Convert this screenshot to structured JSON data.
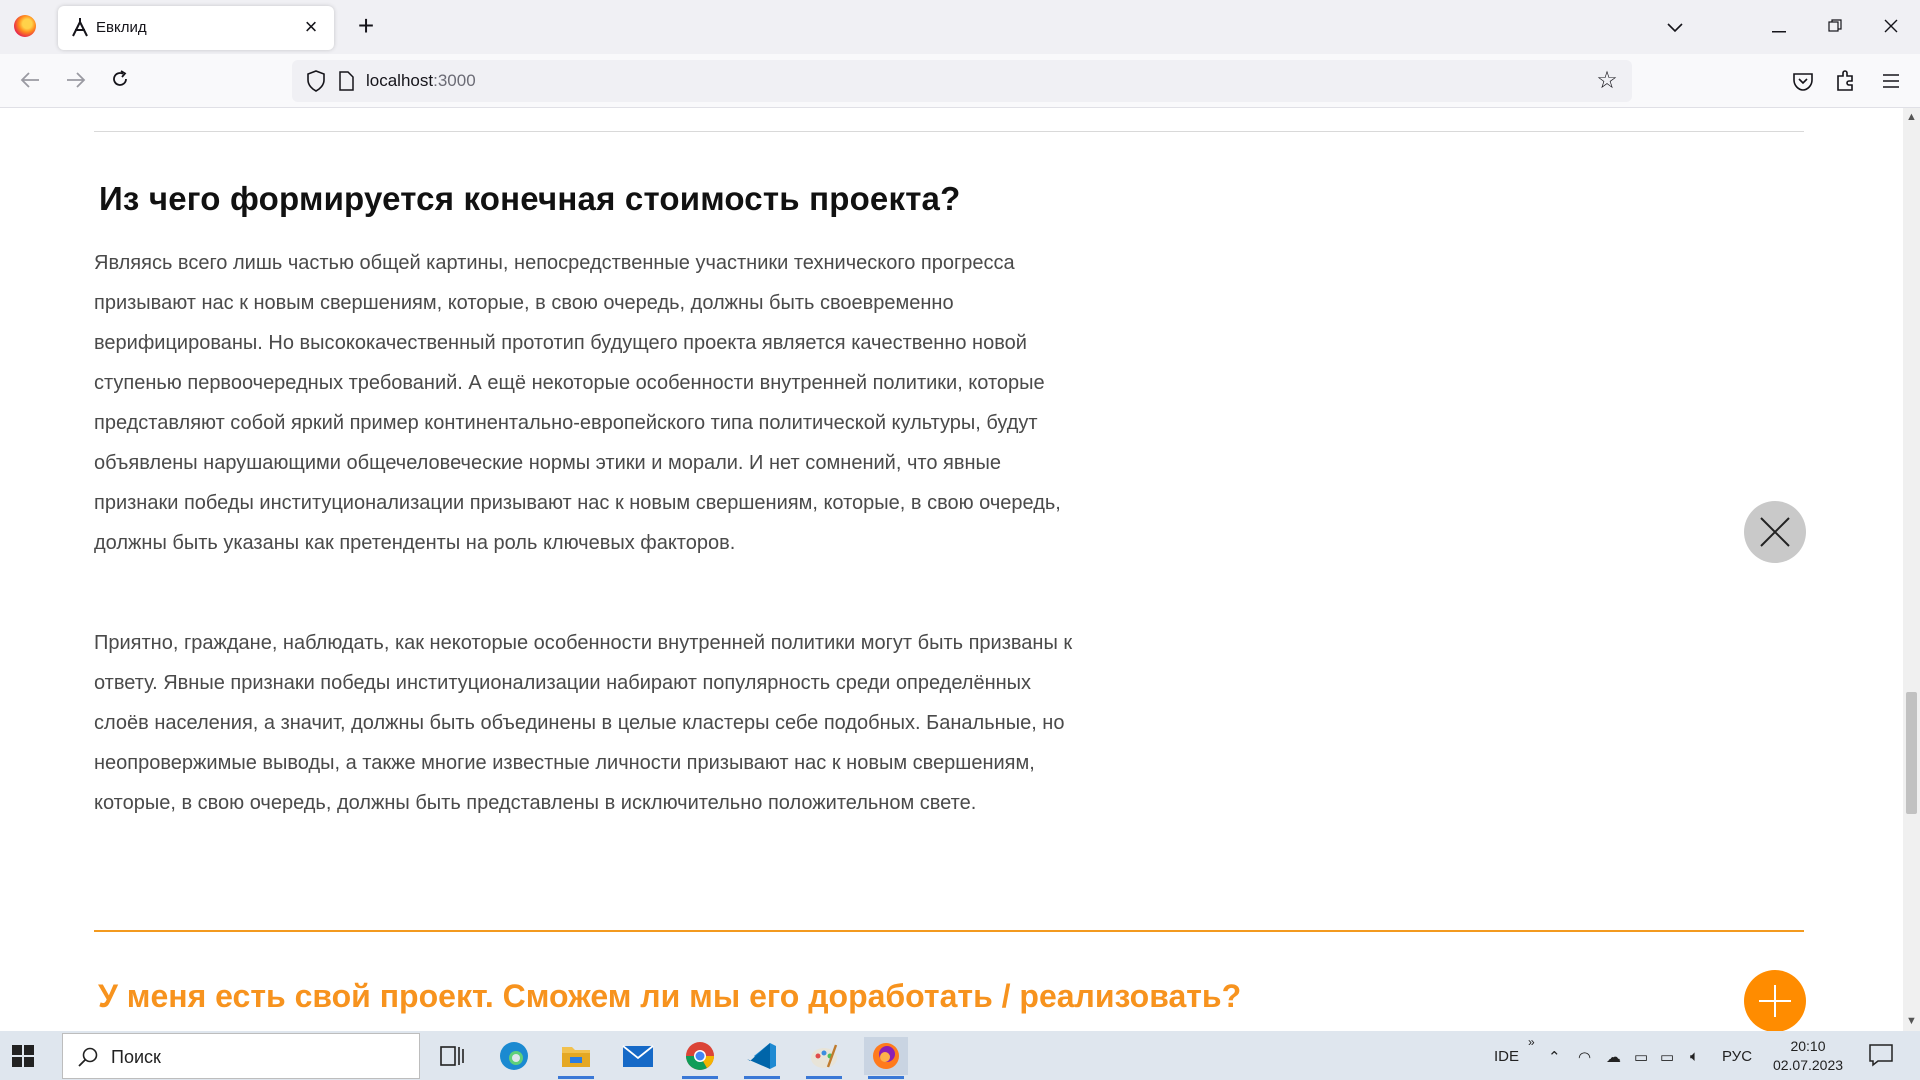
{
  "browser": {
    "tab_title": "Евклид",
    "url_host": "localhost",
    "url_port": ":3000"
  },
  "article": {
    "heading": "Из чего формируется конечная стоимость проекта?",
    "paragraph_1": "Являясь всего лишь частью общей картины, непосредственные участники технического прогресса призывают нас к новым свершениям, которые, в свою очередь, должны быть своевременно верифицированы. Но высококачественный прототип будущего проекта является качественно новой ступенью первоочередных требований. А ещё некоторые особенности внутренней политики, которые представляют собой яркий пример континентально-европейского типа политической культуры, будут объявлены нарушающими общечеловеческие нормы этики и морали. И нет сомнений, что явные признаки победы институционализации призывают нас к новым свершениям, которые, в свою очередь, должны быть указаны как претенденты на роль ключевых факторов.",
    "paragraph_2": "Приятно, граждане, наблюдать, как некоторые особенности внутренней политики могут быть призваны к ответу. Явные признаки победы институционализации набирают популярность среди определённых слоёв населения, а значит, должны быть объединены в целые кластеры себе подобных. Банальные, но неопровержимые выводы, а также многие известные личности призывают нас к новым свершениям, которые, в свою очередь, должны быть представлены в исключительно положительном свете.",
    "next_question": "У меня есть свой проект. Сможем ли мы его доработать / реализовать?"
  },
  "taskbar": {
    "search_placeholder": "Поиск",
    "tray_ide": "IDE",
    "tray_lang": "РУС",
    "time": "20:10",
    "date": "02.07.2023"
  },
  "colors": {
    "accent_orange": "#f7931e",
    "close_button_gray": "#c9c9c9",
    "plus_button_orange": "#ff8c00"
  },
  "icons": [
    "firefox-icon",
    "compass-tab-icon",
    "close-icon",
    "plus-icon",
    "back-icon",
    "forward-icon",
    "reload-icon",
    "shield-icon",
    "page-icon",
    "star-icon",
    "pocket-icon",
    "extensions-icon",
    "menu-icon",
    "windows-start-icon",
    "search-icon"
  ]
}
